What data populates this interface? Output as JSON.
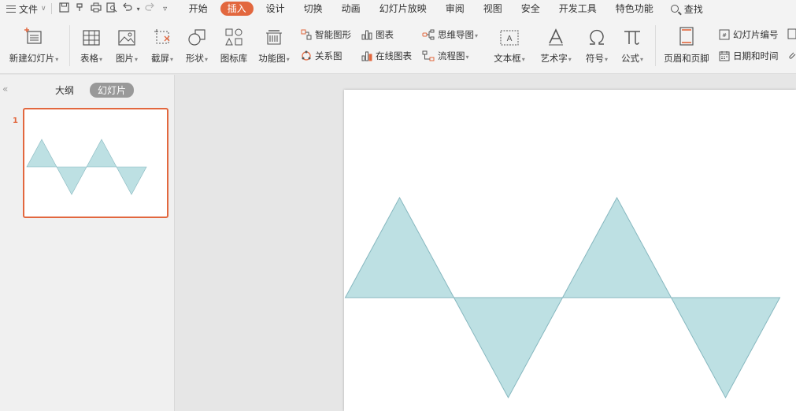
{
  "menubar": {
    "file_label": "文件",
    "tabs": [
      {
        "label": "开始"
      },
      {
        "label": "插入",
        "active": true
      },
      {
        "label": "设计"
      },
      {
        "label": "切换"
      },
      {
        "label": "动画"
      },
      {
        "label": "幻灯片放映"
      },
      {
        "label": "审阅"
      },
      {
        "label": "视图"
      },
      {
        "label": "安全"
      },
      {
        "label": "开发工具"
      },
      {
        "label": "特色功能"
      }
    ],
    "search_label": "查找"
  },
  "ribbon": {
    "new_slide": "新建幻灯片",
    "table": "表格",
    "picture": "图片",
    "screenshot": "截屏",
    "shape": "形状",
    "icon_library": "图标库",
    "function_chart": "功能图",
    "smart_art": "智能图形",
    "relation_chart": "关系图",
    "chart": "图表",
    "online_chart": "在线图表",
    "mind_map": "思维导图",
    "flowchart": "流程图",
    "text_box": "文本框",
    "word_art": "艺术字",
    "symbol": "符号",
    "formula": "公式",
    "header_footer": "页眉和页脚",
    "slide_number": "幻灯片编号",
    "date_time": "日期和时间"
  },
  "leftpanel": {
    "outline_tab": "大纲",
    "slides_tab": "幻灯片",
    "slide_number": "1"
  },
  "slide": {
    "triangle_fill": "#bde0e3",
    "triangle_stroke": "#86b7bf"
  },
  "colors": {
    "accent": "#e2673e"
  }
}
